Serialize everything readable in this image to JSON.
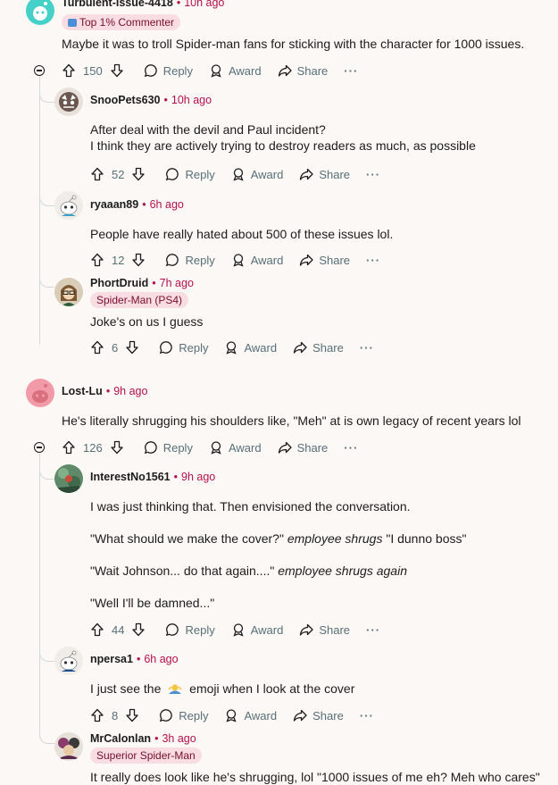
{
  "labels": {
    "reply": "Reply",
    "award": "Award",
    "share": "Share",
    "more": "···"
  },
  "colors": {
    "accent": "#b4104e",
    "flair_bg": "#f9dde3",
    "meta": "#576f76"
  },
  "comments": [
    {
      "user": "Turbulent-Issue-4418",
      "time": "10h ago",
      "flair": "Top 1% Commenter",
      "flair_icon": "trophy-icon",
      "text": [
        "Maybe it was to troll Spider-man fans for sticking with the character for 1000 issues."
      ],
      "score": "150"
    },
    {
      "user": "SnooPets630",
      "time": "10h ago",
      "text": [
        "After deal with the devil and Paul incident?",
        "I think they are actively trying to destroy readers as much, as possible"
      ],
      "score": "52"
    },
    {
      "user": "ryaaan89",
      "time": "6h ago",
      "text": [
        "People have really hated about 500 of these issues lol."
      ],
      "score": "12"
    },
    {
      "user": "PhortDruid",
      "time": "7h ago",
      "flair": "Spider-Man (PS4)",
      "text": [
        "Joke's on us I guess"
      ],
      "score": "6"
    },
    {
      "user": "Lost-Lu",
      "time": "9h ago",
      "text": [
        "He's literally shrugging his shoulders like, \"Meh\" at is own legacy of recent years lol"
      ],
      "score": "126"
    },
    {
      "user": "InterestNo1561",
      "time": "9h ago",
      "p1": "I was just thinking that. Then envisioned the conversation.",
      "p2a": "\"What should we make the cover?\"",
      "p2b": "employee shrugs",
      "p2c": "\"I dunno boss\"",
      "p3a": "\"Wait Johnson... do that again....\"",
      "p3b": "employee shrugs again",
      "p4": "\"Well I'll be damned...\"",
      "score": "44"
    },
    {
      "user": "npersa1",
      "time": "6h ago",
      "text_a": "I just see the",
      "emoji": "person-shrugging-emoji",
      "text_b": "emoji when I look at the cover",
      "score": "8"
    },
    {
      "user": "MrCalonlan",
      "time": "3h ago",
      "flair": "Superior Spider-Man",
      "text": [
        "It really does look like he's shrugging, lol \"1000 issues of me eh? Meh who cares\""
      ]
    }
  ]
}
